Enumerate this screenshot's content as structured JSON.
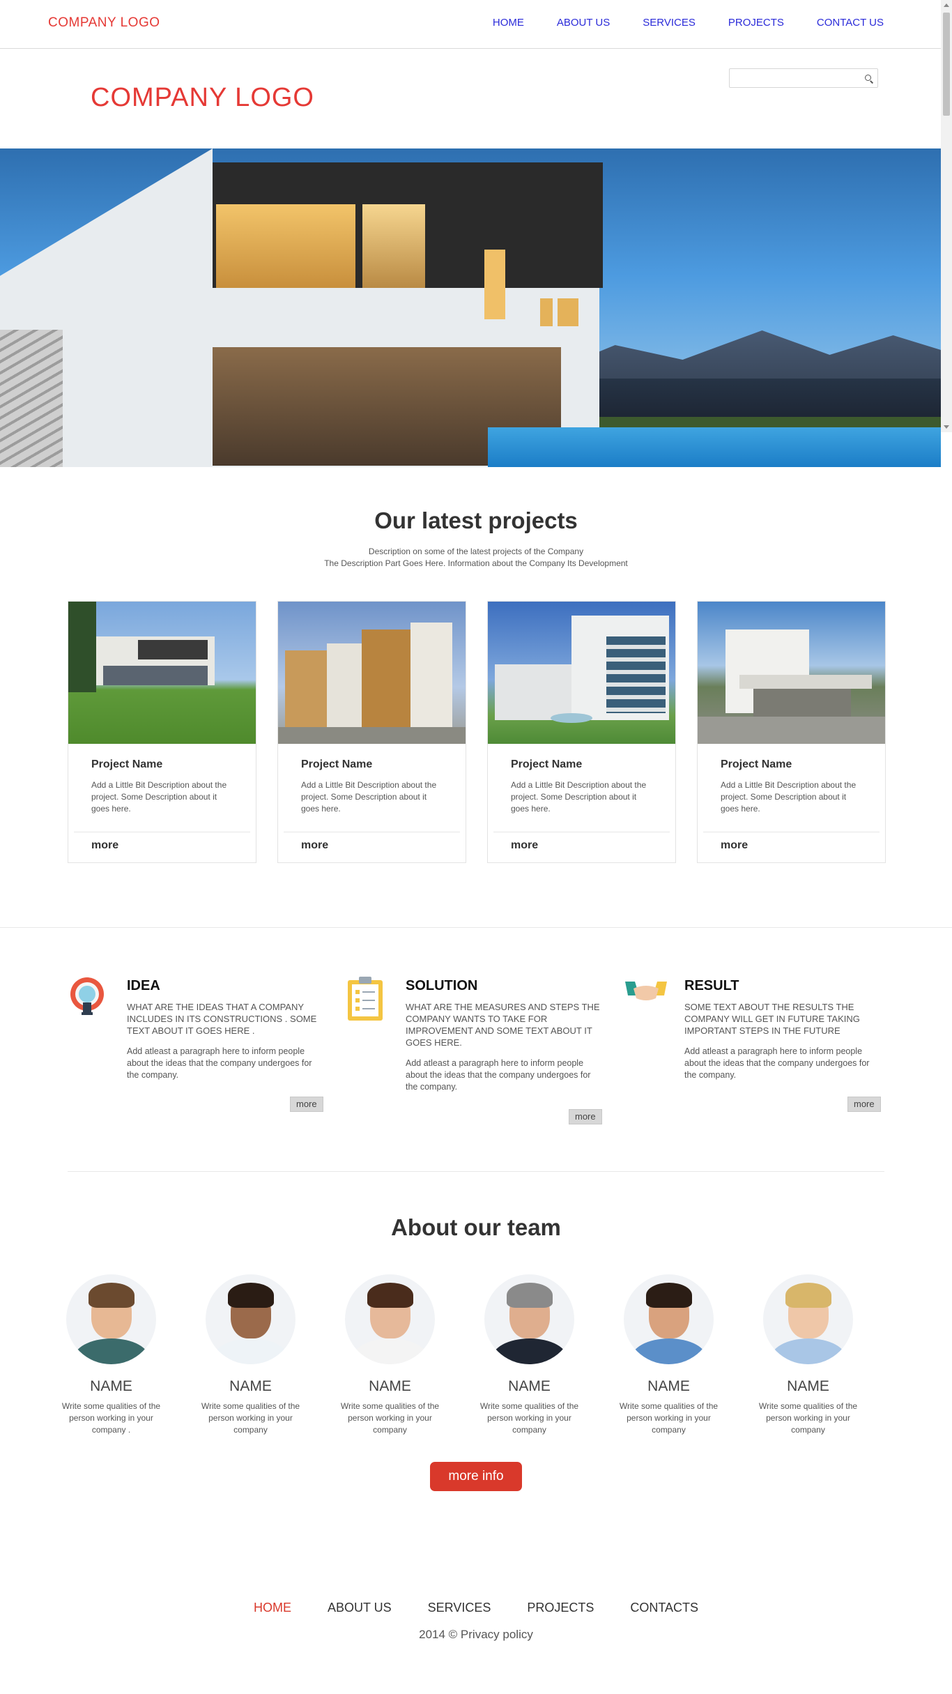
{
  "topbar": {
    "logo": "COMPANY LOGO",
    "nav": [
      "HOME",
      "ABOUT US",
      "SERVICES",
      "PROJECTS",
      "CONTACT US"
    ]
  },
  "header": {
    "logo": "COMPANY LOGO",
    "search_placeholder": ""
  },
  "projects": {
    "title": "Our latest projects",
    "desc_line1": "Description on some of the latest projects of the Company",
    "desc_line2": "The Description Part Goes Here. Information about the Company Its Development",
    "items": [
      {
        "name": "Project Name",
        "desc": "Add a Little Bit Description about the project. Some Description about it goes here.",
        "more": "more"
      },
      {
        "name": "Project Name",
        "desc": "Add a Little Bit Description about the project. Some Description about it goes here.",
        "more": "more"
      },
      {
        "name": "Project Name",
        "desc": "Add a Little Bit Description about the project. Some Description about it goes here.",
        "more": "more"
      },
      {
        "name": "Project Name",
        "desc": "Add a Little Bit Description about the project. Some Description about it goes here.",
        "more": "more"
      }
    ]
  },
  "features": [
    {
      "icon": "lightbulb-icon",
      "title": "IDEA",
      "subtitle": "WHAT ARE THE IDEAS THAT A COMPANY INCLUDES IN ITS CONSTRUCTIONS . SOME TEXT ABOUT IT GOES HERE .",
      "para": "Add atleast a paragraph here to inform people about the ideas that the company undergoes for the company.",
      "more": "more"
    },
    {
      "icon": "clipboard-icon",
      "title": "SOLUTION",
      "subtitle": "WHAT ARE THE MEASURES AND STEPS THE COMPANY WANTS TO TAKE FOR IMPROVEMENT AND SOME TEXT ABOUT IT GOES HERE.",
      "para": "Add atleast a paragraph here to inform people about the ideas that the company undergoes for the company.",
      "more": "more"
    },
    {
      "icon": "handshake-icon",
      "title": "RESULT",
      "subtitle": "SOME TEXT ABOUT THE RESULTS THE COMPANY WILL GET IN FUTURE TAKING IMPORTANT STEPS IN THE FUTURE",
      "para": "Add atleast a paragraph here to inform people about the ideas that the company undergoes for the company.",
      "more": "more"
    }
  ],
  "team": {
    "title": "About our team",
    "members": [
      {
        "name": "NAME",
        "desc": "Write some qualities of the person working in your company ."
      },
      {
        "name": "NAME",
        "desc": "Write some qualities of the person working in your company"
      },
      {
        "name": "NAME",
        "desc": "Write some qualities of the person working in your company"
      },
      {
        "name": "NAME",
        "desc": "Write some qualities of the person working in your company"
      },
      {
        "name": "NAME",
        "desc": "Write some qualities of the person working in your company"
      },
      {
        "name": "NAME",
        "desc": "Write some qualities of the person working in your company"
      }
    ],
    "more_info": "more info"
  },
  "footer": {
    "nav": [
      "HOME",
      "ABOUT US",
      "SERVICES",
      "PROJECTS",
      "CONTACTS"
    ],
    "active": "HOME",
    "copyright": "2014 © Privacy policy"
  },
  "colors": {
    "brand_red": "#e53935",
    "nav_blue": "#2b2bd9",
    "button_red": "#d9392b"
  }
}
